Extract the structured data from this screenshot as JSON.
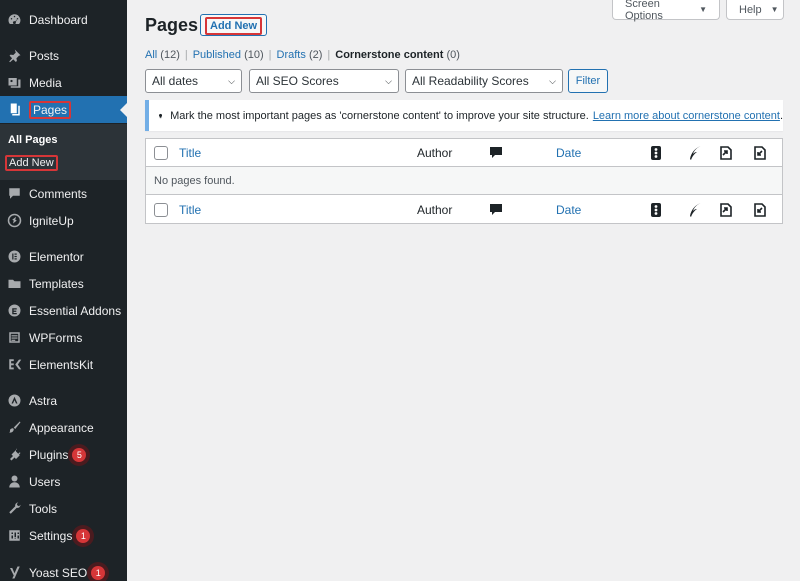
{
  "sidebar": {
    "items": [
      {
        "label": "Dashboard",
        "icon": "dashboard-icon"
      },
      {
        "label": "Posts",
        "icon": "pin-icon"
      },
      {
        "label": "Media",
        "icon": "media-icon"
      },
      {
        "label": "Pages",
        "icon": "page-icon",
        "active": true
      },
      {
        "label": "Comments",
        "icon": "comment-icon"
      },
      {
        "label": "IgniteUp",
        "icon": "igniteup-icon"
      },
      {
        "label": "Elementor",
        "icon": "elementor-icon"
      },
      {
        "label": "Templates",
        "icon": "folder-icon"
      },
      {
        "label": "Essential Addons",
        "icon": "essential-addons-icon"
      },
      {
        "label": "WPForms",
        "icon": "wpforms-icon"
      },
      {
        "label": "ElementsKit",
        "icon": "elementskit-icon"
      },
      {
        "label": "Astra",
        "icon": "astra-icon"
      },
      {
        "label": "Appearance",
        "icon": "brush-icon"
      },
      {
        "label": "Plugins",
        "icon": "plugin-icon",
        "badge": "5"
      },
      {
        "label": "Users",
        "icon": "user-icon"
      },
      {
        "label": "Tools",
        "icon": "wrench-icon"
      },
      {
        "label": "Settings",
        "icon": "settings-icon",
        "badge": "1"
      },
      {
        "label": "Yoast SEO",
        "icon": "yoast-icon",
        "badge": "1"
      }
    ],
    "submenu": [
      {
        "label": "All Pages",
        "current": true
      },
      {
        "label": "Add New"
      }
    ]
  },
  "header": {
    "title": "Pages",
    "add_new": "Add New",
    "screen_options": "Screen Options",
    "help": "Help"
  },
  "views": {
    "all_label": "All",
    "all_count": "(12)",
    "published_label": "Published",
    "published_count": "(10)",
    "drafts_label": "Drafts",
    "drafts_count": "(2)",
    "cornerstone_label": "Cornerstone content",
    "cornerstone_count": "(0)"
  },
  "filters": {
    "dates": "All dates",
    "seo": "All SEO Scores",
    "readability": "All Readability Scores",
    "filter_button": "Filter"
  },
  "notice": {
    "text": "Mark the most important pages as 'cornerstone content' to improve your site structure.",
    "link": "Learn more about cornerstone content",
    "tail": "."
  },
  "table": {
    "col_title": "Title",
    "col_author": "Author",
    "col_date": "Date",
    "empty": "No pages found."
  },
  "colors": {
    "sidebar_bg": "#1d2327",
    "accent": "#2271b1",
    "highlight": "#d63638"
  }
}
